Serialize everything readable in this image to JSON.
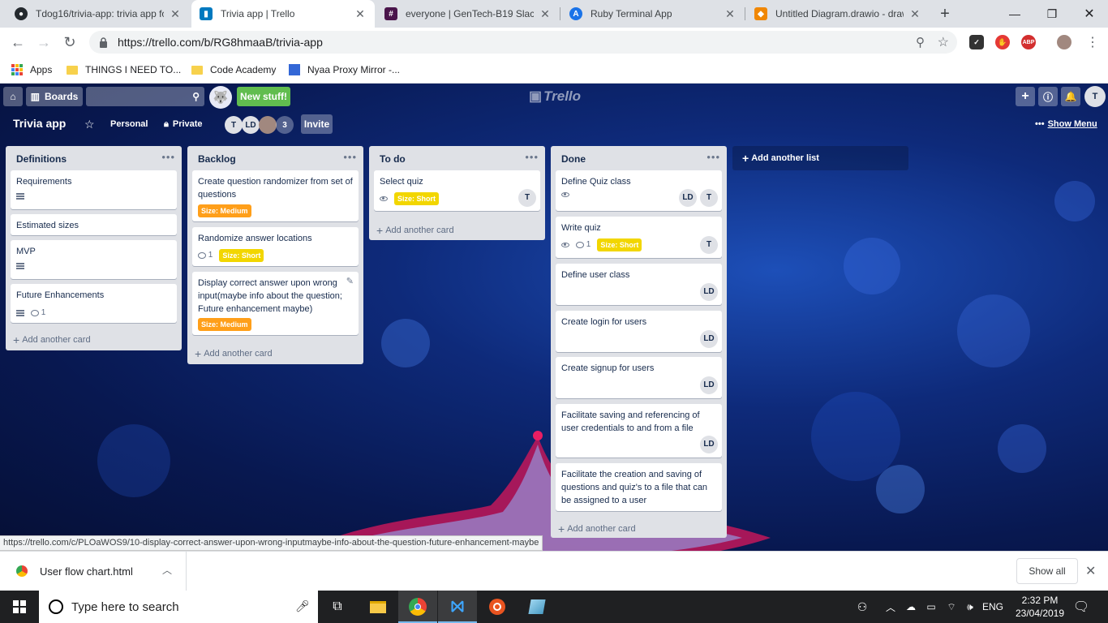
{
  "browser": {
    "tabs": [
      {
        "title": "Tdog16/trivia-app: trivia app fo",
        "favicon": "github-icon",
        "active": false
      },
      {
        "title": "Trivia app | Trello",
        "favicon": "trello-icon",
        "active": true
      },
      {
        "title": "everyone | GenTech-B19 Slack",
        "favicon": "slack-icon",
        "active": false
      },
      {
        "title": "Ruby Terminal App",
        "favicon": "app-icon",
        "active": false
      },
      {
        "title": "Untitled Diagram.drawio - draw",
        "favicon": "drawio-icon",
        "active": false
      }
    ],
    "url": "https://trello.com/b/RG8hmaaB/trivia-app",
    "bookmarks": [
      "Apps",
      "THINGS I NEED TO...",
      "Code Academy",
      "Nyaa Proxy Mirror -..."
    ],
    "extensions": {
      "abp": "ABP"
    }
  },
  "trello": {
    "header": {
      "boards_label": "Boards",
      "new_stuff": "New stuff!",
      "logo": "Trello",
      "avatar": "T"
    },
    "board": {
      "title": "Trivia app",
      "team": "Personal",
      "visibility": "Private",
      "members": [
        "T",
        "LD"
      ],
      "member_extra": "3",
      "invite": "Invite",
      "show_menu": "Show Menu"
    },
    "add_card": "Add another card",
    "add_list": "Add another list",
    "lists": [
      {
        "title": "Definitions",
        "cards": [
          {
            "title": "Requirements"
          },
          {
            "title": "Estimated sizes"
          },
          {
            "title": "MVP"
          },
          {
            "title": "Future Enhancements",
            "comments": "1"
          }
        ]
      },
      {
        "title": "Backlog",
        "cards": [
          {
            "title": "Create question randomizer from set of questions",
            "label": "Size: Medium"
          },
          {
            "title": "Randomize answer locations",
            "comments": "1",
            "label": "Size: Short"
          },
          {
            "title": "Display correct answer upon wrong input(maybe info about the question; Future enhancement maybe)",
            "label": "Size: Medium"
          }
        ]
      },
      {
        "title": "To do",
        "cards": [
          {
            "title": "Select quiz",
            "label": "Size: Short",
            "members": [
              "T"
            ]
          }
        ]
      },
      {
        "title": "Done",
        "cards": [
          {
            "title": "Define Quiz class",
            "members": [
              "LD",
              "T"
            ]
          },
          {
            "title": "Write quiz",
            "comments": "1",
            "label": "Size: Short",
            "members": [
              "T"
            ]
          },
          {
            "title": "Define user class",
            "members": [
              "LD"
            ]
          },
          {
            "title": "Create login for users",
            "members": [
              "LD"
            ]
          },
          {
            "title": "Create signup for users",
            "members": [
              "LD"
            ]
          },
          {
            "title": "Facilitate saving and referencing of user credentials to and from a file",
            "members": [
              "LD"
            ]
          },
          {
            "title": "Facilitate the creation and saving of questions and quiz's to a file that can be assigned to a user"
          }
        ]
      }
    ]
  },
  "status_url": "https://trello.com/c/PLOaWOS9/10-display-correct-answer-upon-wrong-inputmaybe-info-about-the-question-future-enhancement-maybe",
  "download": {
    "file": "User flow chart.html",
    "show_all": "Show all"
  },
  "taskbar": {
    "search_placeholder": "Type here to search",
    "lang": "ENG",
    "time": "2:32 PM",
    "date": "23/04/2019"
  },
  "colors": {
    "label_orange": "#ff9f1a",
    "label_yellow": "#f2d600",
    "new_stuff_green": "#61bd4f",
    "list_bg": "#dfe1e6"
  }
}
